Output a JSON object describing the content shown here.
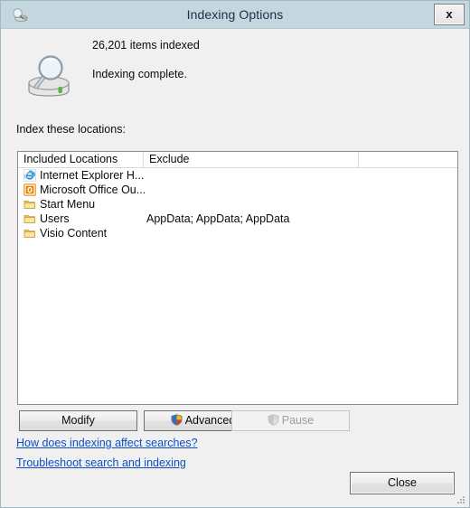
{
  "window": {
    "title": "Indexing Options",
    "icon": "indexing-options-icon",
    "close_label": "x"
  },
  "header": {
    "items_indexed": "26,201 items indexed",
    "status": "Indexing complete.",
    "icon": "drive-magnifier-icon"
  },
  "locations": {
    "label": "Index these locations:",
    "columns": [
      "Included Locations",
      "Exclude",
      ""
    ],
    "rows": [
      {
        "icon": "internet-explorer-icon",
        "name": "Internet Explorer H...",
        "exclude": ""
      },
      {
        "icon": "outlook-icon",
        "name": "Microsoft Office Ou...",
        "exclude": ""
      },
      {
        "icon": "folder-icon",
        "name": "Start Menu",
        "exclude": ""
      },
      {
        "icon": "folder-icon",
        "name": "Users",
        "exclude": "AppData; AppData; AppData"
      },
      {
        "icon": "folder-icon",
        "name": "Visio Content",
        "exclude": ""
      }
    ]
  },
  "buttons": {
    "modify": "Modify",
    "advanced": "Advanced",
    "pause": "Pause",
    "close": "Close",
    "pause_disabled": true
  },
  "links": {
    "how": "How does indexing affect searches?",
    "troubleshoot": "Troubleshoot search and indexing"
  },
  "colors": {
    "titlebar": "#c4d6de",
    "dialog_bg": "#f0f0f0",
    "link": "#0d4ec4",
    "window_border": "#9fb9c4",
    "disabled_text": "#9d9d9d"
  }
}
